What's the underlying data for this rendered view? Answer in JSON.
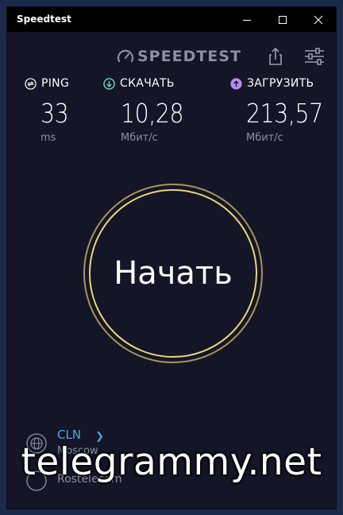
{
  "window": {
    "title": "Speedtest"
  },
  "header": {
    "brand": "SPEEDTEST"
  },
  "metrics": {
    "ping": {
      "label": "PING",
      "value": "33",
      "unit": "ms",
      "icon": "ping-icon",
      "color": "#ffffff"
    },
    "download": {
      "label": "СКАЧАТЬ",
      "value": "10,28",
      "unit": "Мбит/с",
      "icon": "download-icon",
      "color": "#66d9c7"
    },
    "upload": {
      "label": "ЗАГРУЗИТЬ",
      "value": "213,57",
      "unit": "Мбит/с",
      "icon": "upload-icon",
      "color": "#b58cf0"
    }
  },
  "go_button": {
    "label": "Начать",
    "ring_color": "#e9d678"
  },
  "server": {
    "isp": "CLN",
    "location": "Moscow",
    "host": "Rostelecom"
  },
  "watermark": "telegrammy.net",
  "colors": {
    "background": "#141526",
    "accent": "#4aa8e8",
    "muted": "#8c8f9e"
  }
}
